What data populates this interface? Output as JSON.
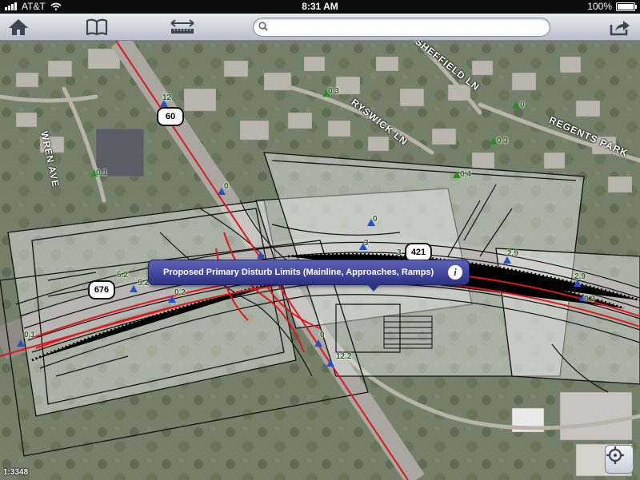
{
  "status_bar": {
    "carrier": "AT&T",
    "time": "8:31 AM",
    "battery": "100%"
  },
  "toolbar": {
    "home_icon": "home-icon",
    "bookmarks_icon": "book-icon",
    "measure_icon": "ruler-arrows-icon",
    "share_icon": "share-arrow-icon",
    "search": {
      "value": "",
      "placeholder": ""
    }
  },
  "map": {
    "streets": [
      "WREN AVE",
      "RYSWICK LN",
      "SHEFFIELD LN",
      "REGENTS PARK"
    ],
    "route_shields": [
      "60",
      "676",
      "421"
    ],
    "mile_markers": [
      "12",
      "0.1",
      "0.3",
      "0",
      "0.3",
      "0.4",
      "0",
      "0",
      "3",
      "3",
      "2.9",
      "2.9",
      "0.2",
      "5.2",
      "5.2",
      "0.2",
      "0.1",
      "0",
      "12.2"
    ],
    "callout": {
      "text": "Proposed Primary Disturb Limits (Mainline, Approaches, Ramps)",
      "info": "i"
    },
    "scale": "1:3348",
    "locate_icon": "crosshair-icon"
  },
  "colors": {
    "route_red": "#e0161c",
    "callout_blue": "#2d3283",
    "marker_blue": "#2251c4",
    "marker_green": "#2e8b22"
  }
}
